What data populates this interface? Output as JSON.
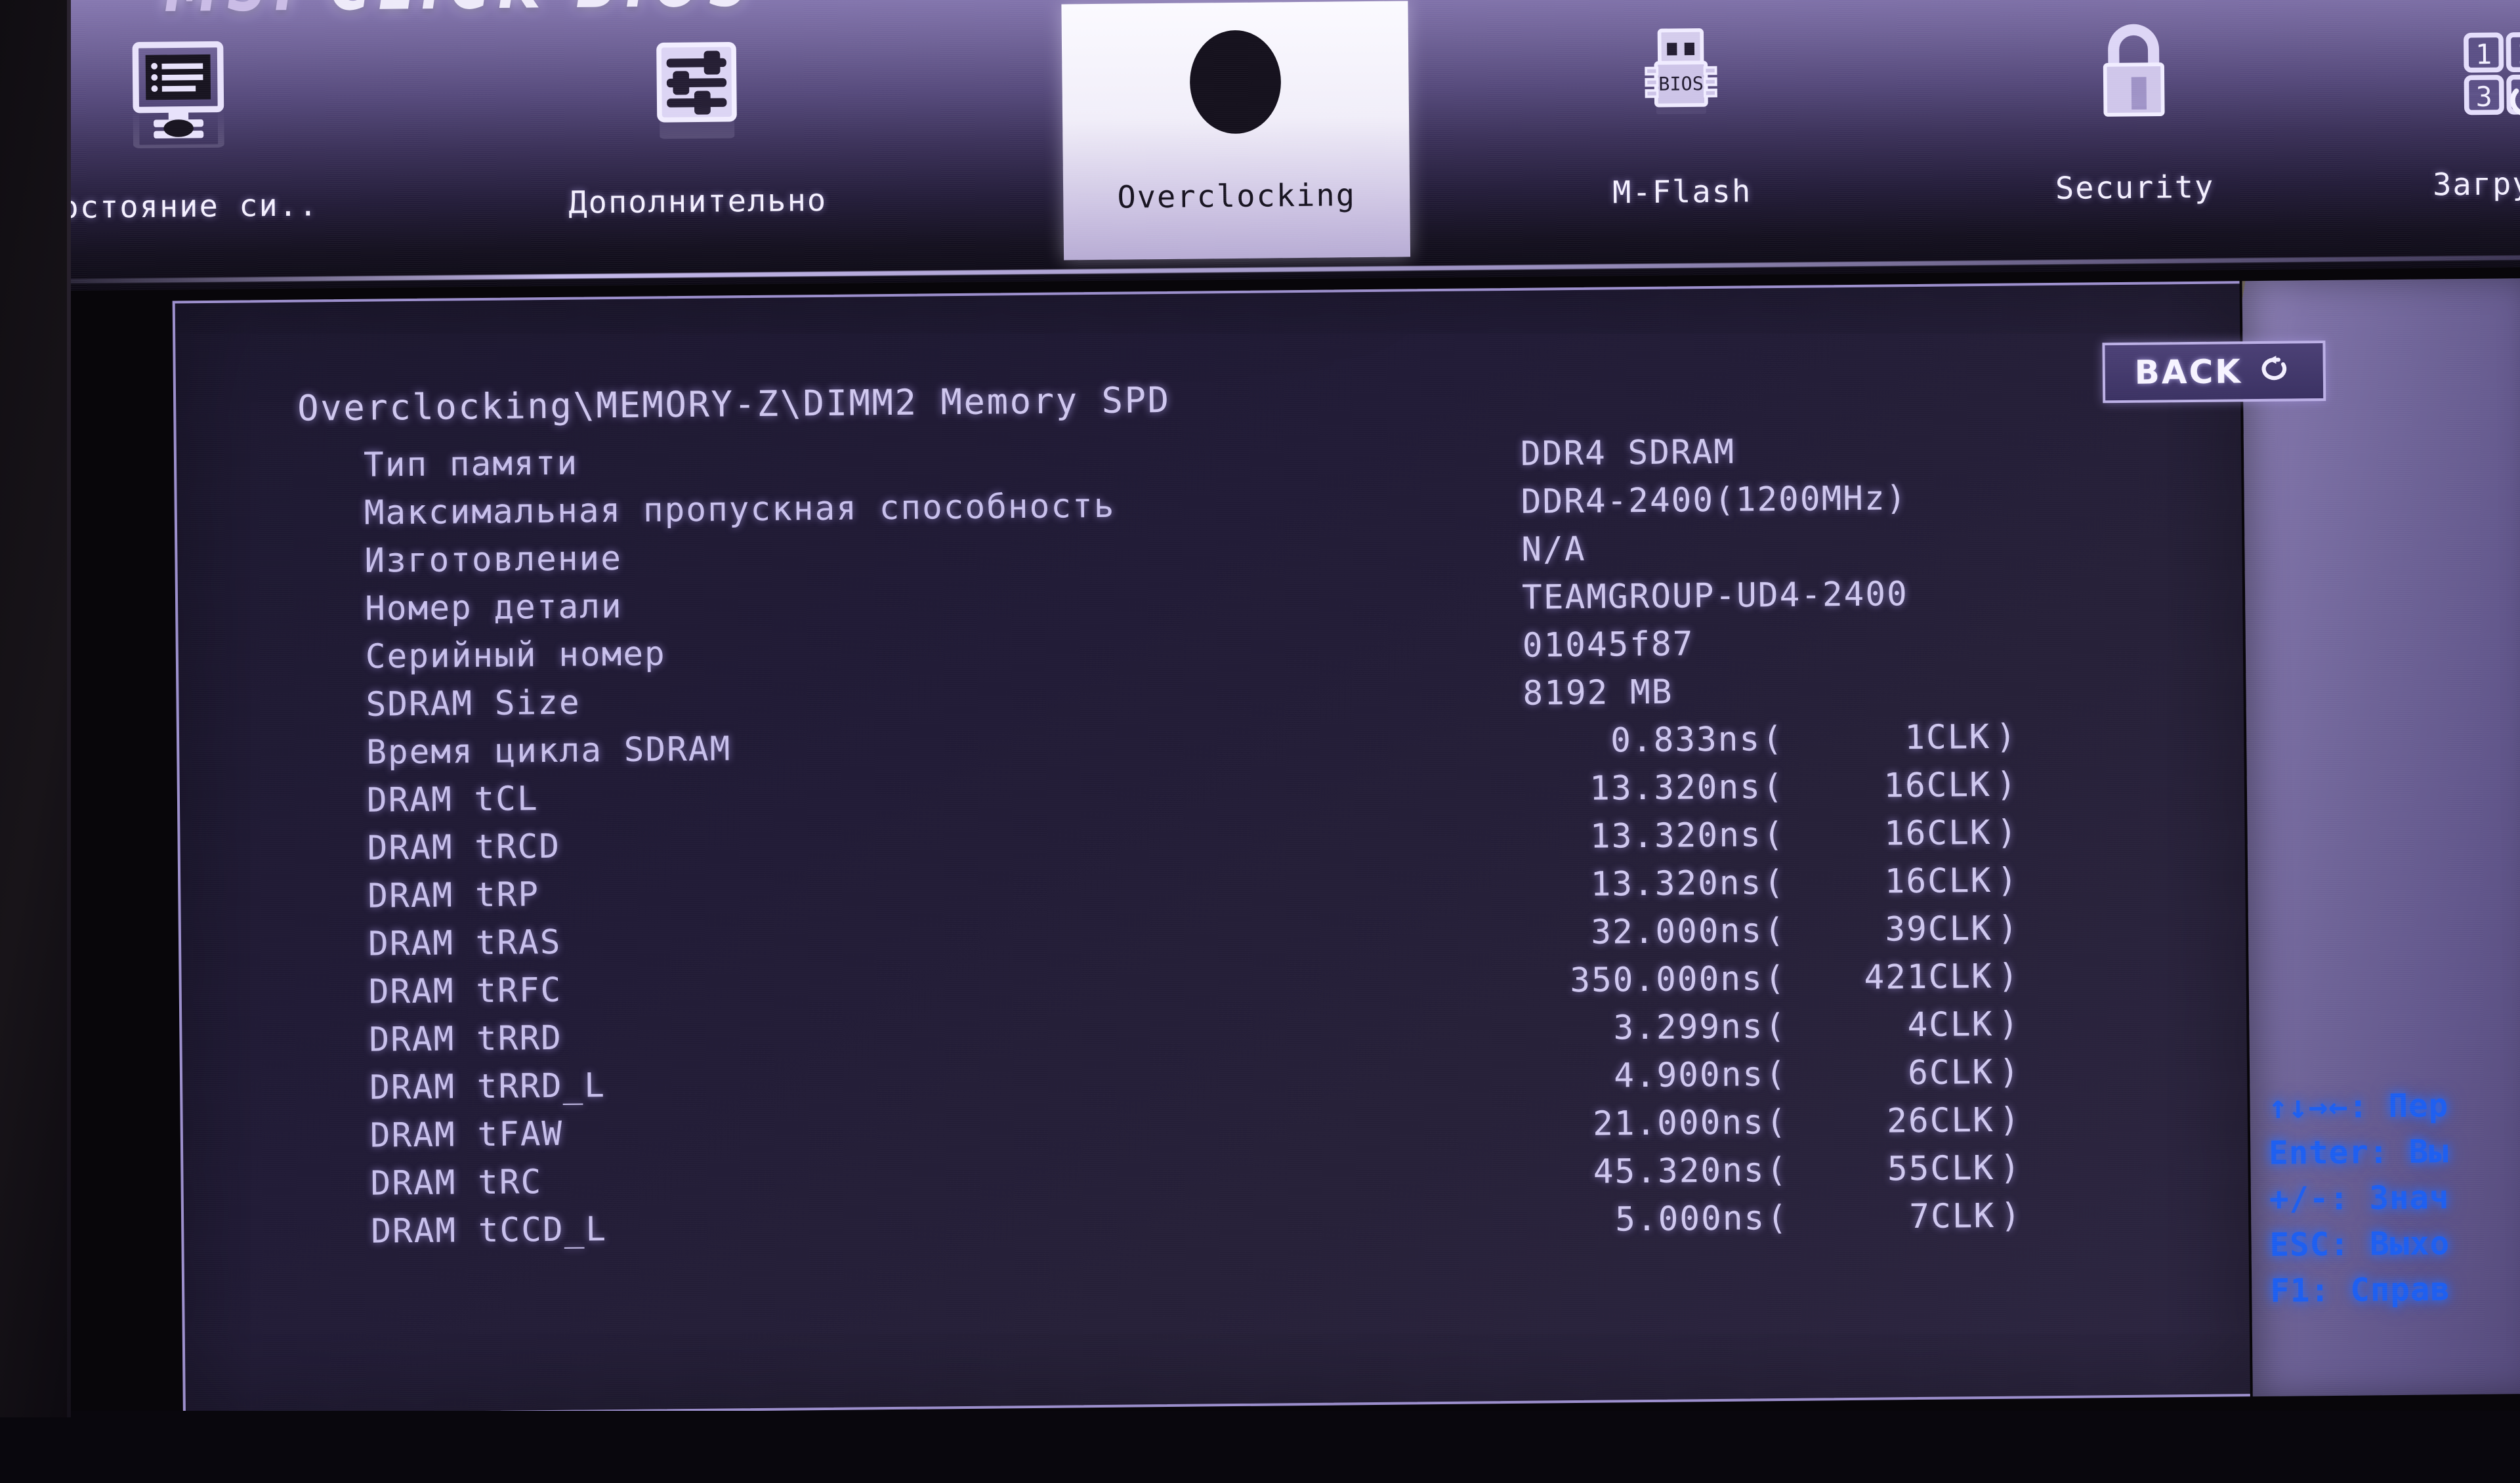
{
  "brand": {
    "vendor": "MSI",
    "product": "CLICK BIOS"
  },
  "tabs": [
    {
      "label": "Состояние си..",
      "icon": "monitor-list-icon",
      "active": false
    },
    {
      "label": "Дополнительно",
      "icon": "sliders-icon",
      "active": false
    },
    {
      "label": "Overclocking",
      "icon": "gauge-icon",
      "active": true
    },
    {
      "label": "M-Flash",
      "icon": "usb-bios-icon",
      "active": false
    },
    {
      "label": "Security",
      "icon": "padlock-icon",
      "active": false
    },
    {
      "label": "Загрузк",
      "icon": "boot-keypad-icon",
      "active": false
    }
  ],
  "breadcrumb": "Overclocking\\MEMORY-Z\\DIMM2 Memory SPD",
  "back_button": {
    "label": "BACK",
    "icon": "undo-arrow-icon"
  },
  "spd": {
    "rows": [
      {
        "label": "Тип памяти",
        "value": "DDR4 SDRAM",
        "type": "text"
      },
      {
        "label": "Максимальная пропускная способность",
        "value": "DDR4-2400(1200MHz)",
        "type": "text"
      },
      {
        "label": "Изготовление",
        "value": "N/A",
        "type": "text"
      },
      {
        "label": "Номер детали",
        "value": "TEAMGROUP-UD4-2400",
        "type": "text"
      },
      {
        "label": "Серийный номер",
        "value": "01045f87",
        "type": "text"
      },
      {
        "label": "SDRAM Size",
        "value": "8192 MB",
        "type": "text"
      },
      {
        "label": "Время цикла SDRAM",
        "ns": "0.833ns",
        "clk": "1CLK",
        "type": "timing"
      },
      {
        "label": "DRAM tCL",
        "ns": "13.320ns",
        "clk": "16CLK",
        "type": "timing"
      },
      {
        "label": "DRAM tRCD",
        "ns": "13.320ns",
        "clk": "16CLK",
        "type": "timing"
      },
      {
        "label": "DRAM tRP",
        "ns": "13.320ns",
        "clk": "16CLK",
        "type": "timing"
      },
      {
        "label": "DRAM tRAS",
        "ns": "32.000ns",
        "clk": "39CLK",
        "type": "timing"
      },
      {
        "label": "DRAM tRFC",
        "ns": "350.000ns",
        "clk": "421CLK",
        "type": "timing"
      },
      {
        "label": "DRAM tRRD",
        "ns": "3.299ns",
        "clk": "4CLK",
        "type": "timing"
      },
      {
        "label": "DRAM tRRD_L",
        "ns": "4.900ns",
        "clk": "6CLK",
        "type": "timing"
      },
      {
        "label": "DRAM tFAW",
        "ns": "21.000ns",
        "clk": "26CLK",
        "type": "timing"
      },
      {
        "label": "DRAM tRC",
        "ns": "45.320ns",
        "clk": "55CLK",
        "type": "timing"
      },
      {
        "label": "DRAM tCCD_L",
        "ns": "5.000ns",
        "clk": "7CLK",
        "type": "timing"
      }
    ],
    "paren_open": "(",
    "paren_close": ")"
  },
  "help": {
    "lines": [
      "↑↓→←: Пер",
      "Enter: Вы",
      "+/-: Знач",
      "ESC: Выхо",
      "F1: Справ"
    ]
  },
  "colors": {
    "accent_purple": "#8c80b4",
    "panel_bg": "#211b36",
    "text_violet": "#c8c0ec",
    "help_blue": "#1c5ef0",
    "active_tab_bg": "#f6f3ff"
  }
}
